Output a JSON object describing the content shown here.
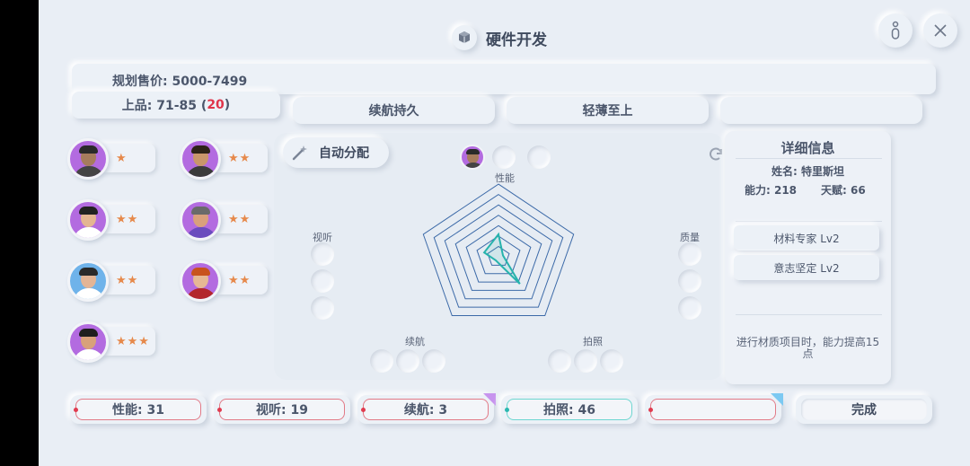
{
  "header": {
    "title": "硬件开发",
    "icon": "cube-icon"
  },
  "plan": {
    "price_label": "规划售价: 5000-7499",
    "quality_prefix": "上品: 71-85 (",
    "quality_highlight": "20",
    "quality_suffix": ")",
    "highlight_color": "#e0344a"
  },
  "features": [
    "续航持久",
    "轻薄至上",
    ""
  ],
  "auto_assign": {
    "label": "自动分配",
    "icon": "magic-wand-icon"
  },
  "staff": [
    {
      "stars": "★",
      "skin": "#a67c5d",
      "hair": "#2a2a2a",
      "bg": "#b36be0",
      "shirt": "#444"
    },
    {
      "stars": "★★",
      "skin": "#c9966b",
      "hair": "#2e2318",
      "bg": "#b36be0",
      "shirt": "#3b3b3b"
    },
    {
      "stars": "★★",
      "skin": "#e4b592",
      "hair": "#222",
      "bg": "#b36be0",
      "shirt": "#fff"
    },
    {
      "stars": "★★",
      "skin": "#d9a07c",
      "hair": "#6a6a6a",
      "bg": "#b36be0",
      "shirt": "#6a4cbe"
    },
    {
      "stars": "★★",
      "skin": "#e3b596",
      "hair": "#2a2a2a",
      "bg": "#6fb3ea",
      "shirt": "#fff"
    },
    {
      "stars": "★★",
      "skin": "#e6b894",
      "hair": "#c8531e",
      "bg": "#b36be0",
      "shirt": "#b3262c"
    },
    {
      "stars": "★★★",
      "skin": "#d8a17b",
      "hair": "#1e1e1e",
      "bg": "#b36be0",
      "shirt": "#fff"
    }
  ],
  "radar": {
    "axes": [
      "性能",
      "质量",
      "拍照",
      "续航",
      "视听"
    ],
    "values": [
      31,
      0,
      46,
      3,
      19
    ]
  },
  "detail": {
    "title": "详细信息",
    "name": "姓名: 特里斯坦",
    "ability": "能力: 218",
    "talent": "天赋: 66",
    "skills": [
      "材料专家  Lv2",
      "意志坚定  Lv2"
    ],
    "description": "进行材质项目时，能力提高15点"
  },
  "stats": [
    {
      "label": "性能: 31",
      "color": "#e27a87"
    },
    {
      "label": "视听: 19",
      "color": "#e27a87"
    },
    {
      "label": "续航: 3",
      "color": "#e27a87",
      "corner": "#c794ee"
    },
    {
      "label": "拍照: 46",
      "color": "#6dd6d0"
    },
    {
      "label": "",
      "color": "#e27a87",
      "corner": "#7cc9f2"
    }
  ],
  "finish": {
    "label": "完成"
  },
  "top_buttons": {
    "info_icon": "info-icon",
    "close_icon": "close-icon"
  }
}
